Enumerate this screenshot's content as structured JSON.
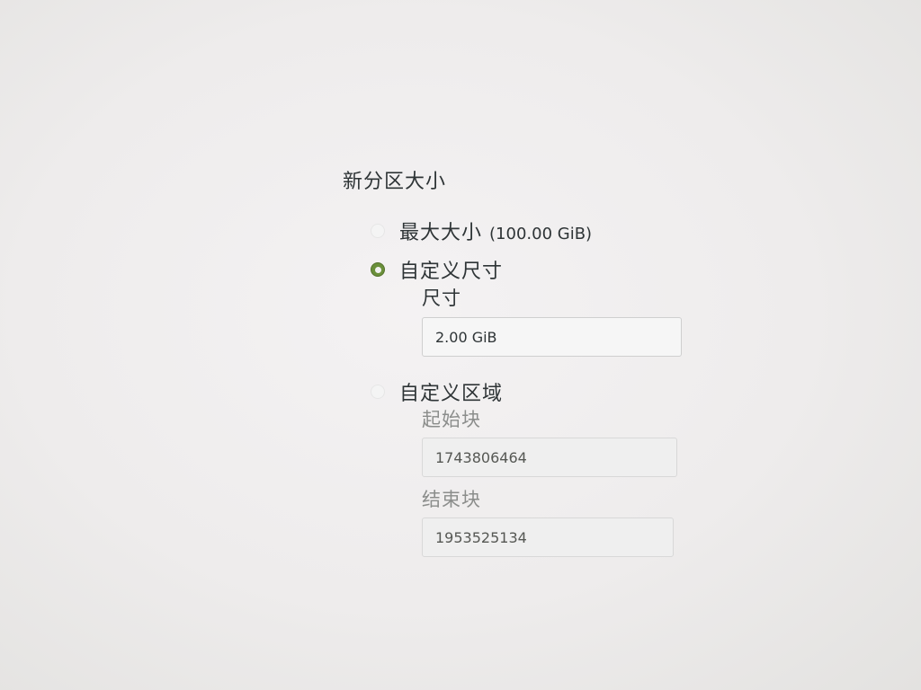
{
  "section": {
    "title": "新分区大小"
  },
  "options": {
    "max_size": {
      "label": "最大大小",
      "size": "(100.00 GiB)",
      "selected": false
    },
    "custom_size": {
      "label": "自定义尺寸",
      "selected": true,
      "size_label": "尺寸",
      "size_value": "2.00 GiB"
    },
    "custom_region": {
      "label": "自定义区域",
      "selected": false,
      "start_label": "起始块",
      "start_value": "1743806464",
      "end_label": "结束块",
      "end_value": "1953525134"
    }
  },
  "colors": {
    "accent": "#6a8f3a",
    "text": "#2e3436",
    "disabled_text": "#8b8d8b"
  },
  "icons": {
    "radio_checked": "radio-checked-icon",
    "radio_unchecked": "radio-unchecked-icon"
  }
}
